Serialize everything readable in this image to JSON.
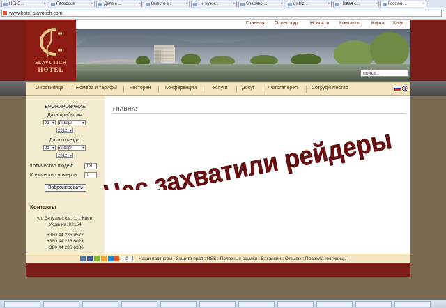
{
  "browser": {
    "tabs": [
      "НЕИЗ...",
      "Facebook",
      "Дело в ...",
      "Вместо з...",
      "Не нужн...",
      "Snapshot...",
      "distriz...",
      "Новая с...",
      "Гостини..."
    ],
    "address": "www.hotel-slavutich.com"
  },
  "site": {
    "logo": {
      "line1": "SLAVUTICH",
      "line2": "HOTEL"
    },
    "top_nav": [
      "Главная",
      "Осветстур",
      "Новости",
      "Контакты",
      "Карта",
      "Киев"
    ],
    "search_placeholder": "поиск...",
    "main_nav": [
      "О гостинице",
      "Номера и тарифы",
      "Ресторан",
      "Конференции",
      "Услуги",
      "Досуг",
      "Фотогалерея",
      "Сотрудничество"
    ],
    "booking": {
      "title": "БРОНИРОВАНИЕ",
      "arrival_label": "Дата прибытия:",
      "arrival_day": "21",
      "arrival_month": "января",
      "arrival_year": "2012",
      "departure_label": "Дата отъезда:",
      "departure_day": "21",
      "departure_month": "января",
      "departure_year": "2012",
      "people_label": "Количество людей:",
      "people_value": "120",
      "rooms_label": "Количество номеров:",
      "rooms_value": "1",
      "submit_label": "Забронировать"
    },
    "contacts": {
      "title": "Контакты",
      "address1": "ул. Энтузиастов, 1, г. Киев,",
      "address2": "Украина, 02154",
      "phone1": "+380 44 236 9572",
      "phone2": "+380 44 236 6023",
      "phone3": "+380 44 236 6336"
    },
    "main_title": "ГЛАВНАЯ",
    "overlay_text": "Нас захватили рейдеры",
    "footer": {
      "counter": "0",
      "links": "Наши партнеры : Защита прав : RSS : Полезные ссылки : Вакансии : Отзывы : Правила гостиницы"
    }
  },
  "colors": {
    "brand_red": "#7c1e17",
    "nav_bg": "#f3e6c0",
    "overlay_text": "#6e0f12"
  }
}
